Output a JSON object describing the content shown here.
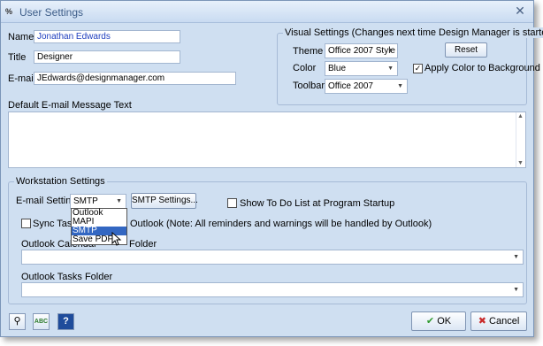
{
  "window": {
    "title": "User Settings",
    "close_symbol": "✕",
    "app_icon": "%"
  },
  "user": {
    "name_label": "Name",
    "name_value": "Jonathan Edwards",
    "title_label": "Title",
    "title_value": "Designer",
    "email_label": "E-mail",
    "email_value": "JEdwards@designmanager.com"
  },
  "visual": {
    "group_title": "Visual Settings (Changes next time Design Manager is started.)",
    "theme_label": "Theme",
    "theme_value": "Office 2007 Style",
    "reset_label": "Reset",
    "color_label": "Color",
    "color_value": "Blue",
    "apply_color_label": "Apply Color to Background",
    "apply_color_checked": "✓",
    "toolbar_label": "Toolbar",
    "toolbar_value": "Office 2007"
  },
  "message": {
    "label": "Default E-mail Message Text",
    "value": ""
  },
  "workstation": {
    "group_title": "Workstation Settings",
    "email_setting_label": "E-mail Setting",
    "email_setting_value": "SMTP",
    "smtp_button_label": "SMTP Settings...",
    "todo_label": "Show To Do List at Program Startup",
    "sync_prefix": "Sync Tasks/",
    "sync_suffix": "Outlook (Note: All reminders and warnings will be handled by Outlook)",
    "email_options": [
      "Outlook",
      "MAPI",
      "SMTP",
      "Save PDF"
    ],
    "calendar_label_start": "Outlook Calendar",
    "calendar_label_end": "Folder",
    "calendar_value": "",
    "tasks_label": "Outlook Tasks Folder",
    "tasks_value": ""
  },
  "footer": {
    "ok_label": "OK",
    "cancel_label": "Cancel",
    "ok_symbol": "✔",
    "cancel_symbol": "✖",
    "search_symbol": "⚲",
    "spell_symbol": "ABC",
    "help_symbol": "?"
  },
  "icons": [
    "window-icon",
    "close-icon",
    "combo-arrow-icon",
    "checkmark-icon",
    "search-key-icon",
    "spellcheck-icon",
    "help-icon",
    "ok-check-icon",
    "cancel-x-icon",
    "mouse-cursor-icon"
  ],
  "colors": {
    "window_bg": "#cfdff1",
    "accent": "#3367c2",
    "ok_green": "#2f9a2f",
    "cancel_red": "#c92a2a"
  }
}
